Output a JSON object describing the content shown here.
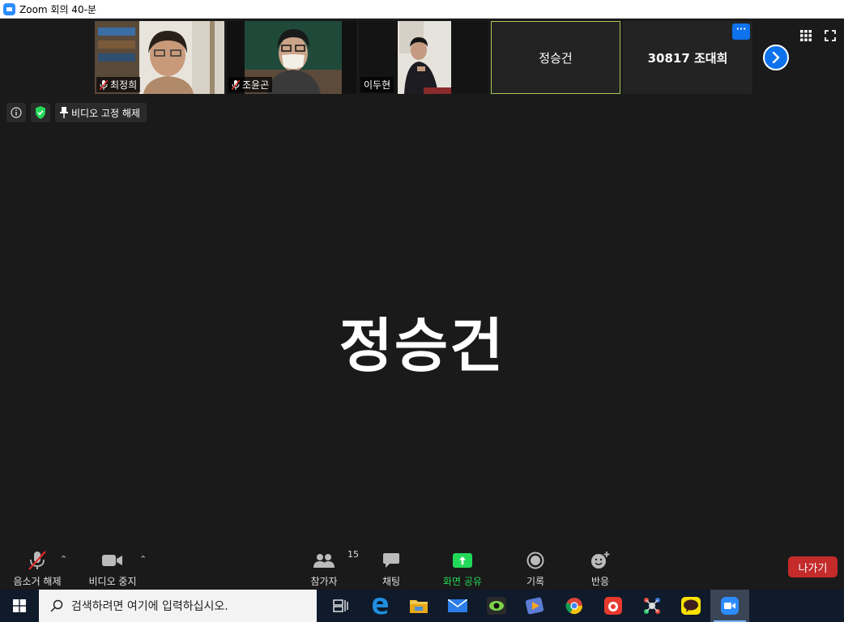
{
  "window": {
    "title": "Zoom 회의 40-분"
  },
  "thumbnails": [
    {
      "name": "최정희",
      "muted": true,
      "video": true
    },
    {
      "name": "조윤곤",
      "muted": true,
      "video": true
    },
    {
      "name": "이두현",
      "muted": false,
      "video": true
    },
    {
      "name": "정승건",
      "muted": false,
      "video": false,
      "active": true
    },
    {
      "name": "30817 조대희",
      "muted": false,
      "video": false
    }
  ],
  "more_label": "···",
  "info_bar": {
    "unpin_label": "비디오 고정 해제"
  },
  "active_speaker": {
    "name": "정승건"
  },
  "toolbar": {
    "unmute_label": "음소거 해제",
    "video_label": "비디오 중지",
    "participants_label": "참가자",
    "participants_count": "15",
    "chat_label": "채팅",
    "share_label": "화면 공유",
    "record_label": "기록",
    "reactions_label": "반응",
    "leave_label": "나가기"
  },
  "taskbar": {
    "search_placeholder": "검색하려면 여기에 입력하십시오."
  },
  "colors": {
    "zoom_blue": "#0e72ed",
    "share_green": "#23d959",
    "leave_red": "#c42b2b",
    "active_border": "#a7c957"
  }
}
